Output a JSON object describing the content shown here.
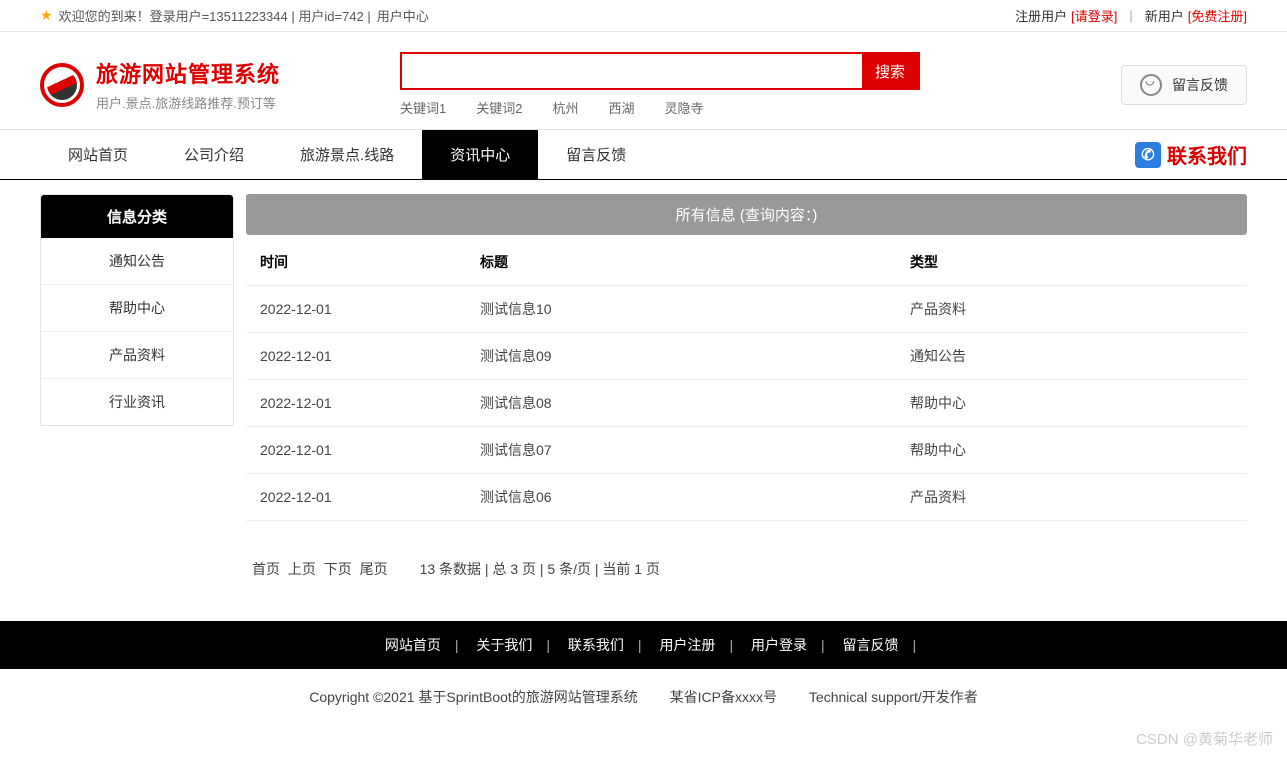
{
  "topbar": {
    "welcome": "欢迎您的到来！登录用户=13511223344 | 用户id=742 | ",
    "usercenter": "用户中心",
    "reg_label": "注册用户",
    "login_link": "[请登录]",
    "new_label": "新用户",
    "free_reg_link": "[免费注册]"
  },
  "brand": {
    "title": "旅游网站管理系统",
    "subtitle": "用户.景点.旅游线路推荐.预订等"
  },
  "search": {
    "button": "搜索",
    "keywords": [
      "关键词1",
      "关键词2",
      "杭州",
      "西湖",
      "灵隐寺"
    ]
  },
  "header_feedback": "留言反馈",
  "nav": {
    "items": [
      {
        "label": "网站首页",
        "active": false
      },
      {
        "label": "公司介绍",
        "active": false
      },
      {
        "label": "旅游景点.线路",
        "active": false
      },
      {
        "label": "资讯中心",
        "active": true
      },
      {
        "label": "留言反馈",
        "active": false
      }
    ],
    "contact": "联系我们"
  },
  "sidebar": {
    "title": "信息分类",
    "items": [
      "通知公告",
      "帮助中心",
      "产品资料",
      "行业资讯"
    ]
  },
  "content": {
    "title": "所有信息 (查询内容：)",
    "headers": {
      "time": "时间",
      "title": "标题",
      "type": "类型"
    },
    "rows": [
      {
        "time": "2022-12-01",
        "title": "测试信息10",
        "type": "产品资料"
      },
      {
        "time": "2022-12-01",
        "title": "测试信息09",
        "type": "通知公告"
      },
      {
        "time": "2022-12-01",
        "title": "测试信息08",
        "type": "帮助中心"
      },
      {
        "time": "2022-12-01",
        "title": "测试信息07",
        "type": "帮助中心"
      },
      {
        "time": "2022-12-01",
        "title": "测试信息06",
        "type": "产品资料"
      }
    ]
  },
  "pager": {
    "first": "首页",
    "prev": "上页",
    "next": "下页",
    "last": "尾页",
    "info": "13 条数据 | 总 3 页 | 5 条/页 | 当前 1 页"
  },
  "footer_nav": [
    "网站首页",
    "关于我们",
    "联系我们",
    "用户注册",
    "用户登录",
    "留言反馈"
  ],
  "footer_copy": {
    "a": "Copyright ©2021 基于SprintBoot的旅游网站管理系统",
    "b": "某省ICP备xxxx号",
    "c": "Technical support/开发作者"
  },
  "watermark": "CSDN @黄菊华老师"
}
